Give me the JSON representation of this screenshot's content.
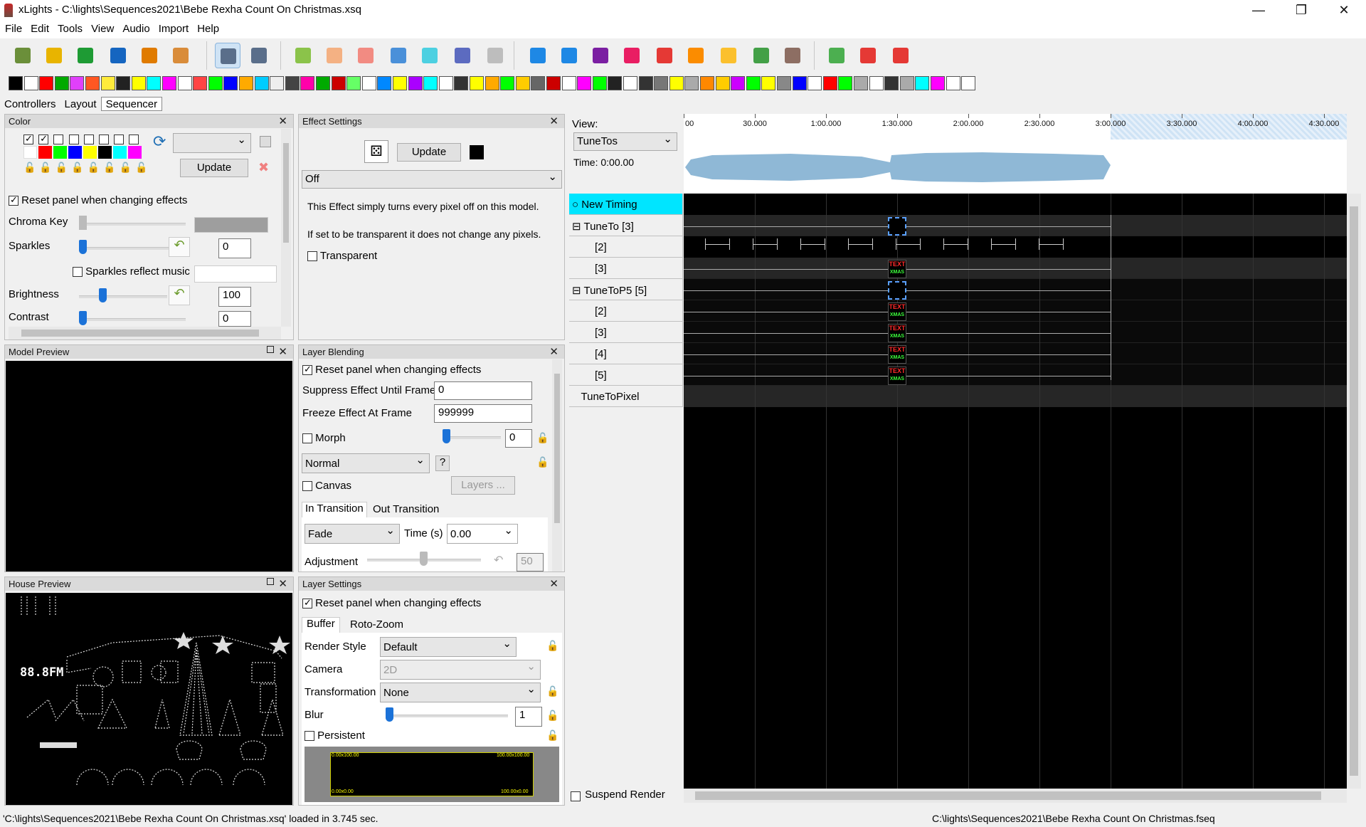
{
  "window": {
    "title": "xLights - C:\\lights\\Sequences2021\\Bebe Rexha Count On Christmas.xsq",
    "minimize": "—",
    "maximize": "❐",
    "close": "✕"
  },
  "menu": [
    "File",
    "Edit",
    "Tools",
    "View",
    "Audio",
    "Import",
    "Help"
  ],
  "toolbar1_icons": [
    {
      "name": "open-folder-icon",
      "color": "#6b8f3a"
    },
    {
      "name": "new-document-icon",
      "color": "#e8b400"
    },
    {
      "name": "open-green-folder-icon",
      "color": "#1e9b34"
    },
    {
      "name": "save-icon",
      "color": "#1565c0"
    },
    {
      "name": "render-all-icon",
      "color": "#e07b00"
    },
    {
      "name": "palette-icon",
      "color": "#d98c3a"
    },
    {
      "name": "timer-icon",
      "color": "#5a6e8a"
    },
    {
      "name": "calendar-icon",
      "color": "#5a6e8a"
    },
    {
      "name": "play-icon",
      "color": "#8bc34a"
    },
    {
      "name": "pause-icon",
      "color": "#f4b183"
    },
    {
      "name": "stop-icon",
      "color": "#f28b82"
    },
    {
      "name": "rewind-icon",
      "color": "#4a90d9"
    },
    {
      "name": "fast-forward-icon",
      "color": "#4dd0e1"
    },
    {
      "name": "replay-icon",
      "color": "#5c6bc0"
    },
    {
      "name": "lightbulb-icon",
      "color": "#bdbdbd"
    },
    {
      "name": "settings-gear-icon",
      "color": "#1e88e5"
    },
    {
      "name": "sliders-icon",
      "color": "#1e88e5"
    },
    {
      "name": "effects-settings-icon",
      "color": "#7b1fa2"
    },
    {
      "name": "layer-blend-icon",
      "color": "#e91e63"
    },
    {
      "name": "color-a-icon",
      "color": "#e53935"
    },
    {
      "name": "house-icon",
      "color": "#fb8c00"
    },
    {
      "name": "layer-settings-icon",
      "color": "#fbc02d"
    },
    {
      "name": "green-gear-icon",
      "color": "#43a047"
    },
    {
      "name": "brush-icon",
      "color": "#8d6e63"
    },
    {
      "name": "zoom-in-icon",
      "color": "#4caf50"
    },
    {
      "name": "zoom-out-icon",
      "color": "#e53935"
    },
    {
      "name": "jukebox-icon",
      "color": "#e53935"
    }
  ],
  "effect_palette": [
    "#000",
    "#fff",
    "#f00",
    "#0a0",
    "#e040fb",
    "#ff5722",
    "#ffeb3b",
    "#222",
    "#ff0",
    "#0ff",
    "#f0f",
    "#fff",
    "#f44",
    "#0f0",
    "#00f",
    "#fa0",
    "#0cf",
    "#eee",
    "#444",
    "#f0a",
    "#0a0",
    "#c00",
    "#6f6",
    "#fff",
    "#08f",
    "#ff0",
    "#a0f",
    "#0ff",
    "#fff",
    "#333",
    "#ff0",
    "#fa0",
    "#0f0",
    "#fc0",
    "#666",
    "#c00",
    "#fff",
    "#f0f",
    "#0f0",
    "#222",
    "#fff",
    "#333",
    "#777",
    "#ff0",
    "#aaa",
    "#f80",
    "#fc0",
    "#c0f",
    "#0f0",
    "#ff0",
    "#888",
    "#00f",
    "#fff",
    "#f00",
    "#0f0",
    "#aaa",
    "#fff",
    "#333",
    "#aaa",
    "#0ff",
    "#f0f",
    "#fff",
    "#fff"
  ],
  "tabs": {
    "controllers": "Controllers",
    "layout": "Layout",
    "sequencer": "Sequencer"
  },
  "color_panel": {
    "title": "Color",
    "swatches": [
      "#ffffff",
      "#ff0000",
      "#00ff00",
      "#0000ff",
      "#ffff00",
      "#000000",
      "#00ffff",
      "#ff00ff"
    ],
    "update": "Update",
    "reset_label": "Reset panel when changing effects",
    "chroma_key": "Chroma Key",
    "sparkles": "Sparkles",
    "sparkles_value": "0",
    "sparkles_reflect": "Sparkles reflect music",
    "brightness": "Brightness",
    "brightness_value": "100",
    "contrast": "Contrast",
    "contrast_value": "0"
  },
  "effect_settings": {
    "title": "Effect Settings",
    "update": "Update",
    "effect": "Off",
    "desc1": "This Effect simply turns every pixel off on this model.",
    "desc2": "If set to be transparent it does not change any pixels.",
    "transparent": "Transparent"
  },
  "model_preview": {
    "title": "Model Preview"
  },
  "house_preview": {
    "title": "House Preview",
    "clock_text": "88.8FM"
  },
  "layer_blending": {
    "title": "Layer Blending",
    "reset_label": "Reset panel when changing effects",
    "suppress_label": "Suppress Effect Until Frame",
    "suppress_value": "0",
    "freeze_label": "Freeze Effect At Frame",
    "freeze_value": "999999",
    "morph": "Morph",
    "morph_value": "0",
    "blend_mode": "Normal",
    "help": "?",
    "canvas": "Canvas",
    "layers_btn": "Layers ...",
    "in_transition": "In Transition",
    "out_transition": "Out Transition",
    "transition_type": "Fade",
    "time_label": "Time (s)",
    "time_value": "0.00",
    "adjustment": "Adjustment",
    "adjustment_value": "50"
  },
  "layer_settings": {
    "title": "Layer Settings",
    "reset_label": "Reset panel when changing effects",
    "tab_buffer": "Buffer",
    "tab_roto": "Roto-Zoom",
    "render_style_label": "Render Style",
    "render_style": "Default",
    "camera_label": "Camera",
    "camera": "2D",
    "transformation_label": "Transformation",
    "transformation": "None",
    "blur_label": "Blur",
    "blur_value": "1",
    "persistent": "Persistent",
    "buffer_tl": "0.00x100.00",
    "buffer_tr": "100.00x100.00",
    "buffer_bl": "0.00x0.00",
    "buffer_br": "100.00x0.00"
  },
  "sequencer": {
    "view_label": "View:",
    "view_value": "TuneTos",
    "time_label": "Time: 0:00.00",
    "ticks": [
      "00",
      "30.000",
      "1:00.000",
      "1:30.000",
      "2:00.000",
      "2:30.000",
      "3:00.000",
      "3:30.000",
      "4:00.000",
      "4:30.000"
    ],
    "rows": [
      "New Timing",
      "TuneTo [3]",
      "[2]",
      "[3]",
      "TuneToP5 [5]",
      "[2]",
      "[3]",
      "[4]",
      "[5]",
      "TuneToPixel"
    ],
    "suspend_render": "Suspend Render",
    "text_icon_top": "TEXT",
    "text_icon_bottom": "XMAS"
  },
  "status": {
    "left": "'C:\\lights\\Sequences2021\\Bebe Rexha Count On Christmas.xsq' loaded in 3.745 sec.",
    "right": "C:\\lights\\Sequences2021\\Bebe Rexha Count On Christmas.fseq"
  }
}
